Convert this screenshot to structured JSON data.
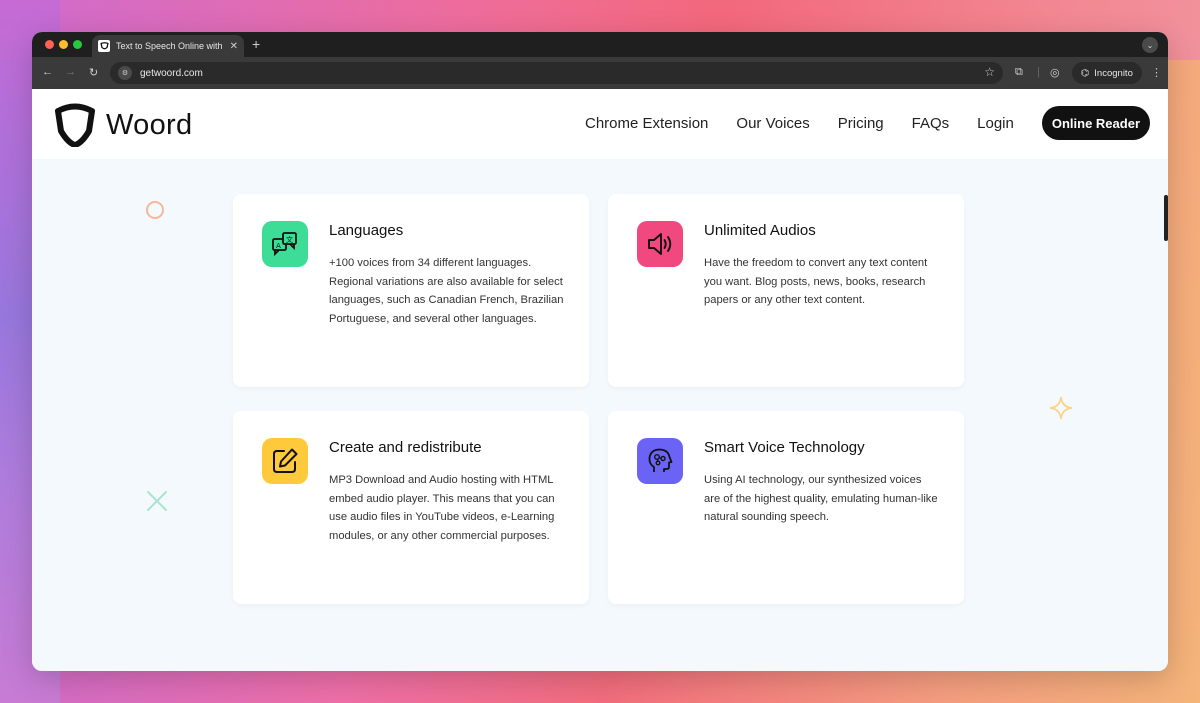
{
  "browser": {
    "tab_title": "Text to Speech Online with N...",
    "url": "getwoord.com",
    "incognito_label": "Incognito"
  },
  "site": {
    "logo_text": "Woord",
    "nav": {
      "chrome_extension": "Chrome Extension",
      "our_voices": "Our Voices",
      "pricing": "Pricing",
      "faqs": "FAQs",
      "login": "Login",
      "online_reader": "Online Reader"
    }
  },
  "features": [
    {
      "title": "Languages",
      "text": "+100 voices from 34 different languages. Regional variations are also available for select languages, such as Canadian French, Brazilian Portuguese, and several other languages.",
      "icon": "translate-icon",
      "color": "#3ddc97"
    },
    {
      "title": "Unlimited Audios",
      "text": "Have the freedom to convert any text content you want. Blog posts, news, books, research papers or any other text content.",
      "icon": "speaker-icon",
      "color": "#f0487f"
    },
    {
      "title": "Create and redistribute",
      "text": "MP3 Download and Audio hosting with HTML embed audio player. This means that you can use audio files in YouTube videos, e-Learning modules, or any other commercial purposes.",
      "icon": "edit-icon",
      "color": "#ffc93c"
    },
    {
      "title": "Smart Voice Technology",
      "text": "Using AI technology, our synthesized voices are of the highest quality, emulating human-like natural sounding speech.",
      "icon": "ai-head-icon",
      "color": "#6b63f5"
    }
  ]
}
